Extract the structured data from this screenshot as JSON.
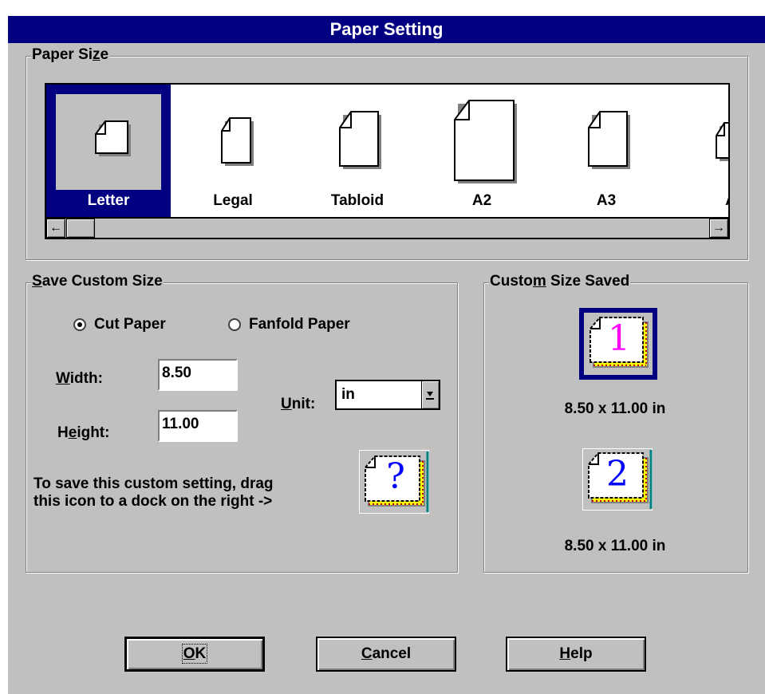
{
  "dialog": {
    "title": "Paper Setting"
  },
  "paper_size": {
    "legend_pre": "Paper Si",
    "legend_accel": "z",
    "legend_post": "e",
    "items": [
      {
        "label": "Letter",
        "selected": true,
        "icon": "letter-page-icon"
      },
      {
        "label": "Legal",
        "selected": false,
        "icon": "legal-page-icon"
      },
      {
        "label": "Tabloid",
        "selected": false,
        "icon": "tabloid-page-icon"
      },
      {
        "label": "A2",
        "selected": false,
        "icon": "a2-page-icon"
      },
      {
        "label": "A3",
        "selected": false,
        "icon": "a3-page-icon"
      },
      {
        "label": "A",
        "selected": false,
        "icon": "a4-page-icon"
      }
    ],
    "scroll_left_glyph": "←",
    "scroll_right_glyph": "→"
  },
  "save_custom": {
    "legend_accel": "S",
    "legend_post": "ave Custom Size",
    "radio_cut": "Cut Paper",
    "radio_fanfold": "Fanfold Paper",
    "selected_radio": "Cut Paper",
    "width_accel": "W",
    "width_post": "idth:",
    "width_value": "8.50",
    "height_pre": "H",
    "height_accel": "e",
    "height_post": "ight:",
    "height_value": "11.00",
    "unit_accel": "U",
    "unit_post": "nit:",
    "unit_value": "in",
    "note_line1": "To save this custom setting, drag",
    "note_line2": "this icon to a dock on the right ->",
    "drag_icon_glyph": "?"
  },
  "custom_saved": {
    "legend_pre": "Custo",
    "legend_accel": "m",
    "legend_post": " Size Saved",
    "docks": [
      {
        "glyph": "1",
        "caption": "8.50 x 11.00 in",
        "selected": true
      },
      {
        "glyph": "2",
        "caption": "8.50 x 11.00 in",
        "selected": false
      }
    ]
  },
  "buttons": {
    "ok_accel": "O",
    "ok_post": "K",
    "cancel_accel": "C",
    "cancel_post": "ancel",
    "help_accel": "H",
    "help_post": "elp"
  },
  "colors": {
    "title_bar": "#000080",
    "dialog_face": "#c0c0c0",
    "selection": "#000080",
    "dock1_digit": "#ff00ff",
    "dock2_digit": "#0000ff",
    "dock_fold": "#ffff00"
  }
}
